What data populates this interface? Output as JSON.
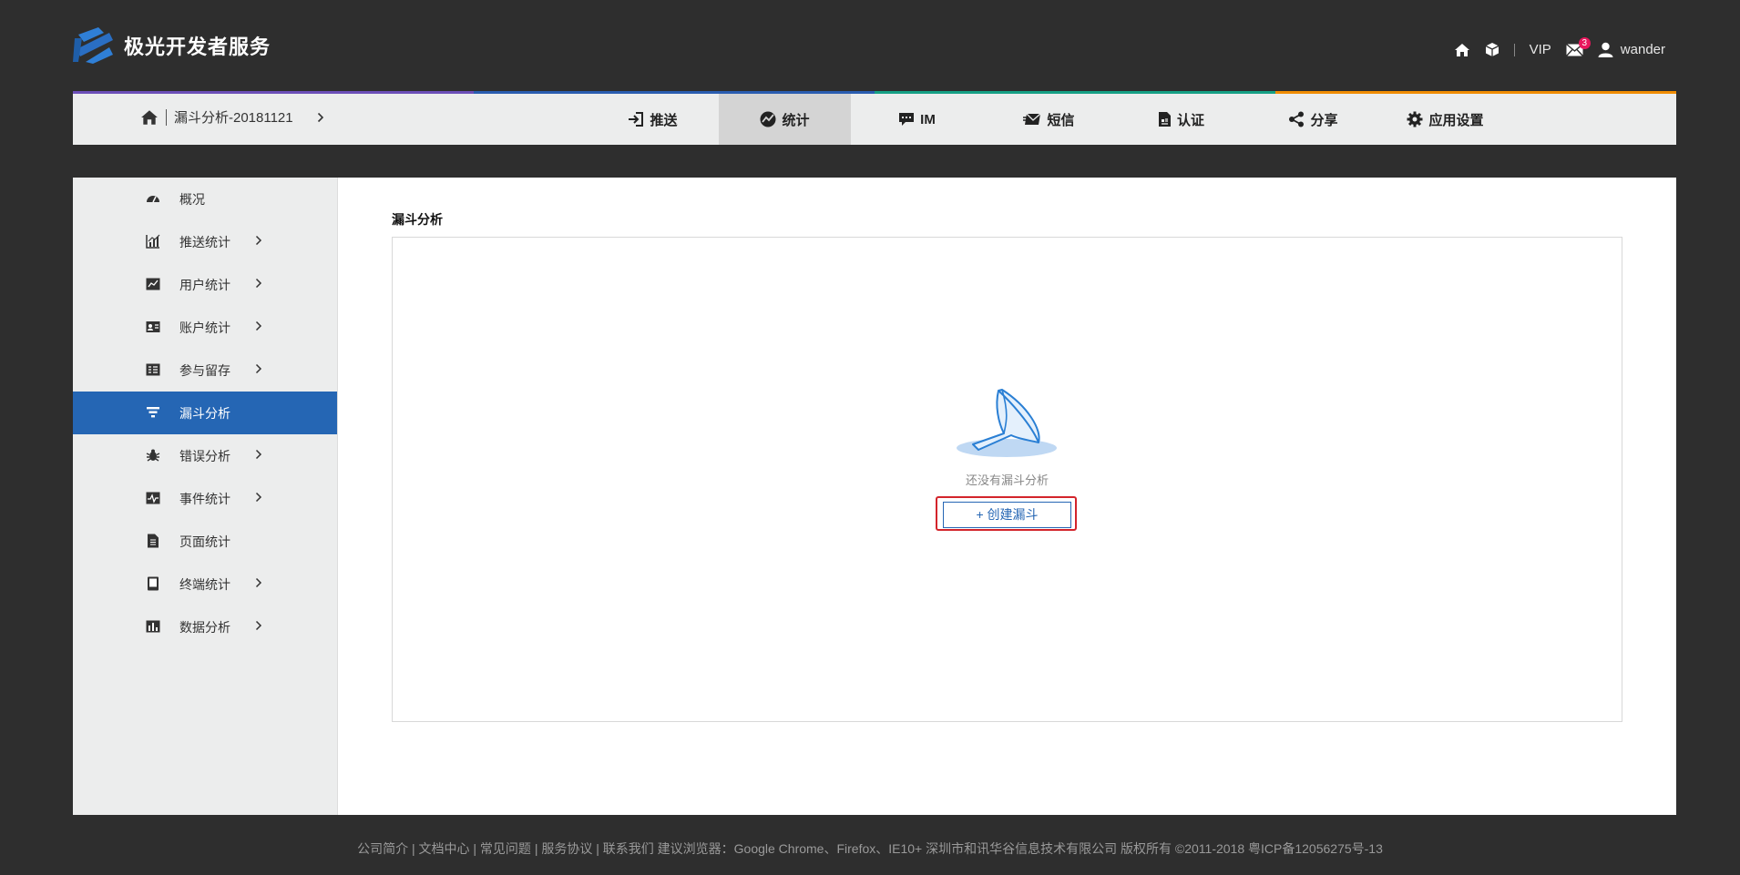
{
  "brand": {
    "name": "极光开发者服务"
  },
  "top_right": {
    "icons": [
      "home-icon",
      "cube-icon"
    ],
    "vip_label": "VIP",
    "mail_icon": "mail-icon",
    "mail_badge": "3",
    "user_icon": "user-icon",
    "username": "wander"
  },
  "colors": {
    "stripe": [
      "#6c4fb8",
      "#2a5db0",
      "#16a085",
      "#f08c00"
    ],
    "accent": "#2566b4",
    "highlight_outline": "#d3242b",
    "badge": "#e8175d"
  },
  "breadcrumb": {
    "icon": "home-icon",
    "app_name": "漏斗分析-20181121",
    "arrow_icon": "chevron-right-icon"
  },
  "nav_tabs": [
    {
      "icon": "sign-in-icon",
      "label": "推送"
    },
    {
      "icon": "stats-icon",
      "label": "统计",
      "active": true
    },
    {
      "icon": "chat-icon",
      "label": "IM"
    },
    {
      "icon": "envelope-send-icon",
      "label": "短信"
    },
    {
      "icon": "id-card-icon",
      "label": "认证"
    },
    {
      "icon": "share-icon",
      "label": "分享"
    },
    {
      "icon": "gear-icon",
      "label": "应用设置"
    }
  ],
  "sidebar": {
    "items": [
      {
        "icon": "dashboard-icon",
        "label": "概况",
        "has_submenu": false
      },
      {
        "icon": "area-chart-icon",
        "label": "推送统计",
        "has_submenu": true
      },
      {
        "icon": "line-chart-icon",
        "label": "用户统计",
        "has_submenu": true
      },
      {
        "icon": "account-card-icon",
        "label": "账户统计",
        "has_submenu": true
      },
      {
        "icon": "retention-table-icon",
        "label": "参与留存",
        "has_submenu": true
      },
      {
        "icon": "funnel-icon",
        "label": "漏斗分析",
        "has_submenu": false,
        "active": true
      },
      {
        "icon": "bug-icon",
        "label": "错误分析",
        "has_submenu": true
      },
      {
        "icon": "event-pulse-icon",
        "label": "事件统计",
        "has_submenu": true
      },
      {
        "icon": "document-icon",
        "label": "页面统计",
        "has_submenu": false
      },
      {
        "icon": "tablet-icon",
        "label": "终端统计",
        "has_submenu": true
      },
      {
        "icon": "bar-chart-icon",
        "label": "数据分析",
        "has_submenu": true
      }
    ]
  },
  "content": {
    "title": "漏斗分析",
    "empty_text": "还没有漏斗分析",
    "create_button": "+ 创建漏斗"
  },
  "footer": {
    "text": "公司简介 | 文档中心 | 常见问题 | 服务协议 | 联系我们   建议浏览器：Google Chrome、Firefox、IE10+   深圳市和讯华谷信息技术有限公司 版权所有 ©2011-2018 粤ICP备12056275号-13"
  }
}
